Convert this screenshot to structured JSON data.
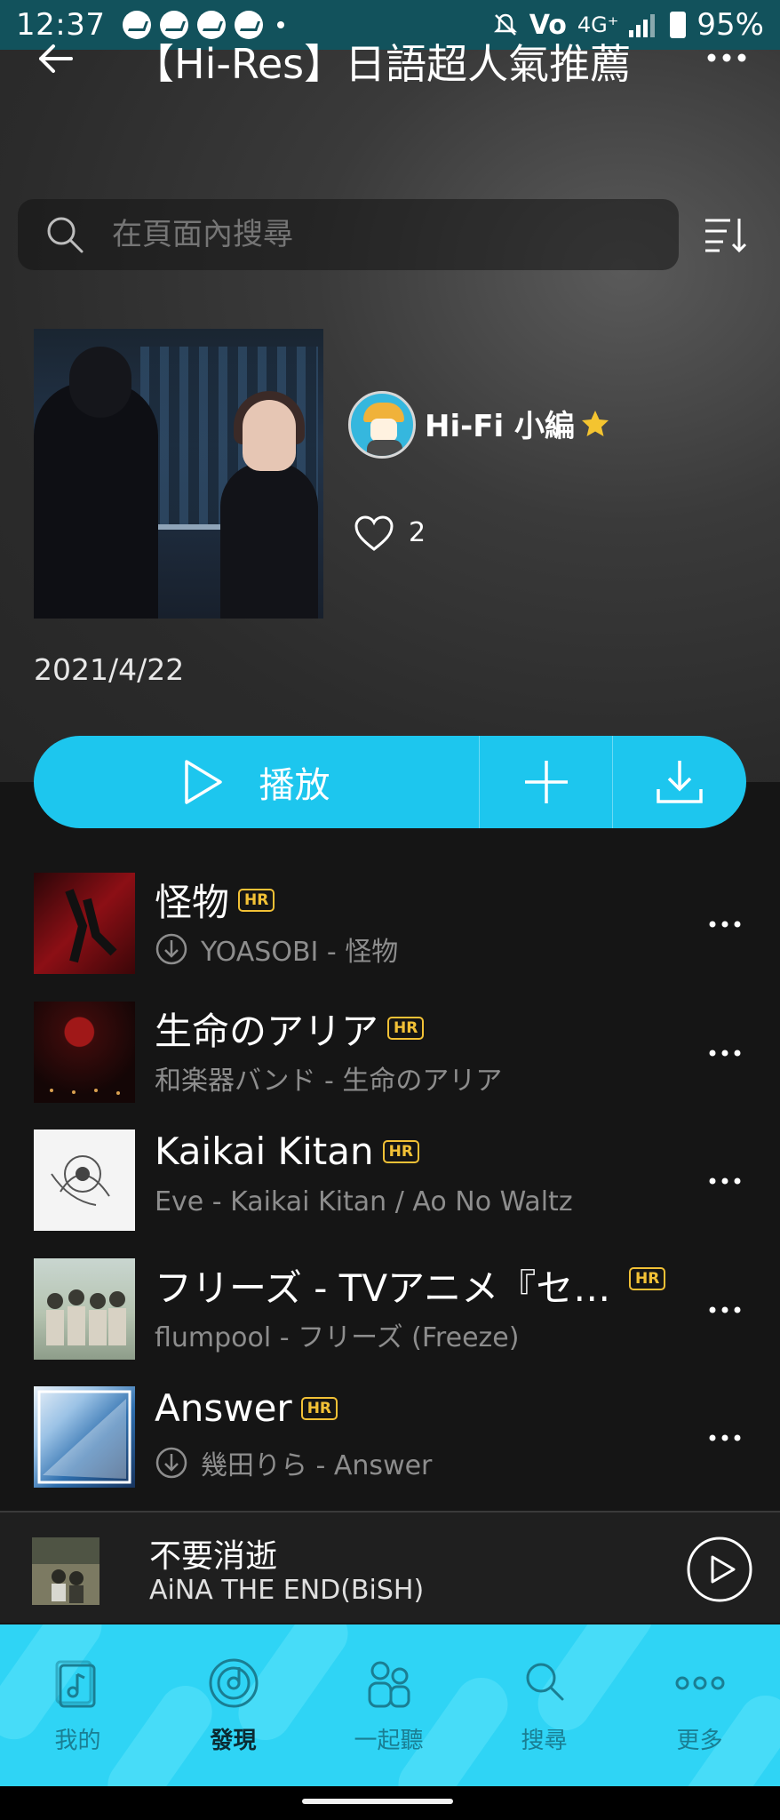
{
  "status": {
    "time": "12:37",
    "network": "4G⁺",
    "volte": "Vo",
    "battery": "95%"
  },
  "header": {
    "title": "【Hi-Res】日語超人氣推薦"
  },
  "search": {
    "placeholder": "在頁面內搜尋"
  },
  "playlist": {
    "curator": "Hi-Fi 小編",
    "likes": "2",
    "date": "2021/4/22"
  },
  "actions": {
    "play_label": "播放"
  },
  "tracks": [
    {
      "title": "怪物",
      "badge": "HR",
      "subtitle": "YOASOBI - 怪物",
      "downloaded": true
    },
    {
      "title": "生命のアリア",
      "badge": "HR",
      "subtitle": "和楽器バンド - 生命のアリア",
      "downloaded": false
    },
    {
      "title": "Kaikai Kitan",
      "badge": "HR",
      "subtitle": "Eve - Kaikai Kitan / Ao No Waltz",
      "downloaded": false
    },
    {
      "title": "フリーズ - TVアニメ『セ…",
      "badge": "HR",
      "subtitle": "flumpool - フリーズ (Freeze)",
      "downloaded": false
    },
    {
      "title": "Answer",
      "badge": "HR",
      "subtitle": "幾田りら - Answer",
      "downloaded": true
    }
  ],
  "now_playing": {
    "title": "不要消逝",
    "artist": "AiNA THE END(BiSH)"
  },
  "tabs": [
    {
      "label": "我的",
      "icon": "music-note-icon"
    },
    {
      "label": "發現",
      "icon": "disc-icon"
    },
    {
      "label": "一起聽",
      "icon": "people-icon"
    },
    {
      "label": "搜尋",
      "icon": "search-icon"
    },
    {
      "label": "更多",
      "icon": "more-icon"
    }
  ],
  "colors": {
    "accent": "#1dc6ee",
    "tabbar": "#2fd4f5",
    "badge": "#f2c136",
    "status_bar": "#12525c"
  }
}
